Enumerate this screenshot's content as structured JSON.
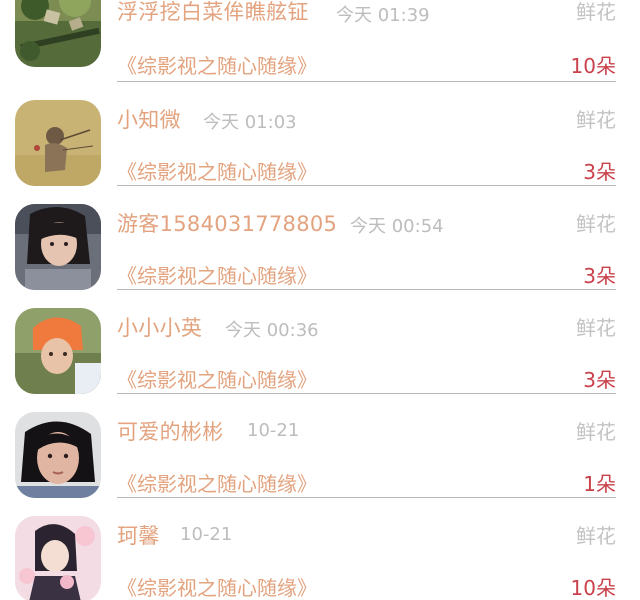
{
  "rows": [
    {
      "name": "浮浮挖白菜侔瞧舷钲",
      "time": "今天 01:39",
      "gift": "鲜花",
      "title": "《综影视之随心随缘》",
      "amount": "10朵"
    },
    {
      "name": "小知微",
      "time": "今天 01:03",
      "gift": "鲜花",
      "title": "《综影视之随心随缘》",
      "amount": "3朵"
    },
    {
      "name": "游客1584031778805",
      "time": "今天 00:54",
      "gift": "鲜花",
      "title": "《综影视之随心随缘》",
      "amount": "3朵"
    },
    {
      "name": "小小小英",
      "time": "今天 00:36",
      "gift": "鲜花",
      "title": "《综影视之随心随缘》",
      "amount": "3朵"
    },
    {
      "name": "可爱的彬彬",
      "time": "10-21",
      "gift": "鲜花",
      "title": "《综影视之随心随缘》",
      "amount": "1朵"
    },
    {
      "name": "珂馨",
      "time": "10-21",
      "gift": "鲜花",
      "title": "《综影视之随心随缘》",
      "amount": "10朵"
    }
  ]
}
